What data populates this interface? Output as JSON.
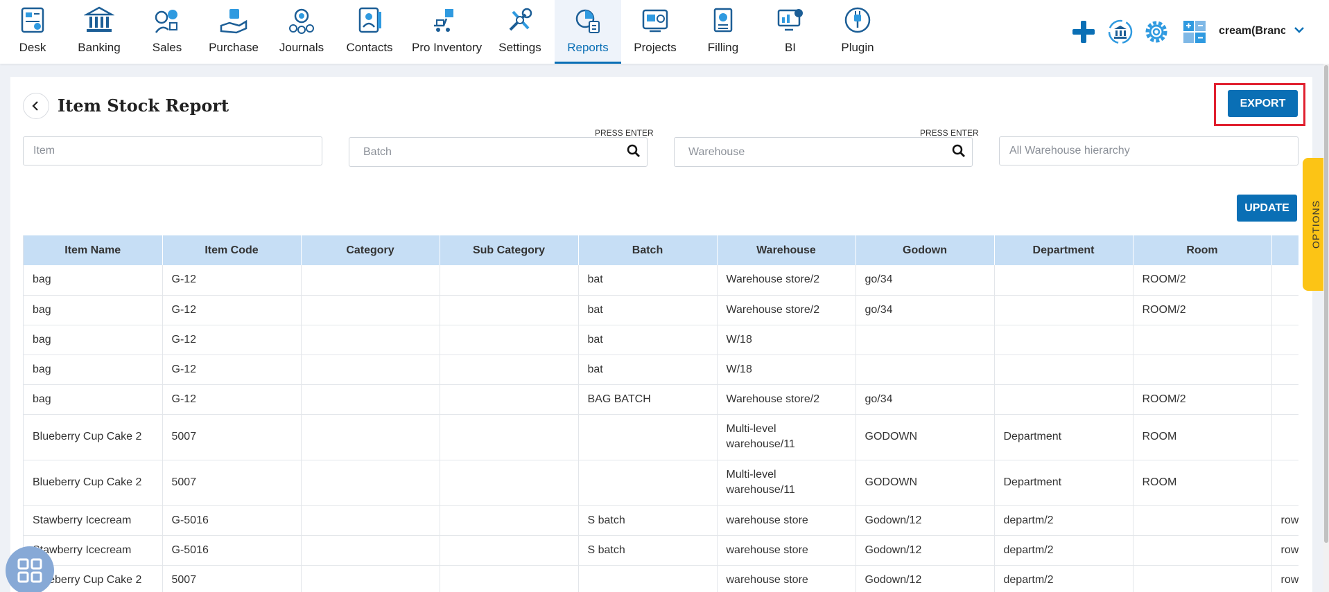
{
  "nav": {
    "items": [
      {
        "label": "Desk",
        "icon": "desk-icon"
      },
      {
        "label": "Banking",
        "icon": "bank-icon"
      },
      {
        "label": "Sales",
        "icon": "sales-icon"
      },
      {
        "label": "Purchase",
        "icon": "purchase-icon"
      },
      {
        "label": "Journals",
        "icon": "journal-icon"
      },
      {
        "label": "Contacts",
        "icon": "contacts-icon"
      },
      {
        "label": "Pro Inventory",
        "icon": "inventory-icon"
      },
      {
        "label": "Settings",
        "icon": "tools-icon"
      },
      {
        "label": "Reports",
        "icon": "reports-icon",
        "active": true
      },
      {
        "label": "Projects",
        "icon": "projects-icon"
      },
      {
        "label": "Filling",
        "icon": "filing-icon"
      },
      {
        "label": "BI",
        "icon": "bi-icon"
      },
      {
        "label": "Plugin",
        "icon": "plugin-icon"
      }
    ],
    "user_name": "cream(Branch"
  },
  "page": {
    "title": "Item Stock Report",
    "export_label": "EXPORT",
    "update_label": "UPDATE",
    "options_label": "OPTIONS",
    "press_enter": "PRESS ENTER"
  },
  "filters": {
    "item_placeholder": "Item",
    "batch_placeholder": "Batch",
    "warehouse_placeholder": "Warehouse",
    "hierarchy_placeholder": "All Warehouse hierarchy"
  },
  "table": {
    "headers": [
      "Item Name",
      "Item Code",
      "Category",
      "Sub Category",
      "Batch",
      "Warehouse",
      "Godown",
      "Department",
      "Room",
      ""
    ],
    "rows": [
      [
        "bag",
        "G-12",
        "",
        "",
        "bat",
        "Warehouse store/2",
        "go/34",
        "",
        "ROOM/2",
        ""
      ],
      [
        "bag",
        "G-12",
        "",
        "",
        "bat",
        "Warehouse store/2",
        "go/34",
        "",
        "ROOM/2",
        ""
      ],
      [
        "bag",
        "G-12",
        "",
        "",
        "bat",
        "W/18",
        "",
        "",
        "",
        ""
      ],
      [
        "bag",
        "G-12",
        "",
        "",
        "bat",
        "W/18",
        "",
        "",
        "",
        ""
      ],
      [
        "bag",
        "G-12",
        "",
        "",
        "BAG BATCH",
        "Warehouse store/2",
        "go/34",
        "",
        "ROOM/2",
        ""
      ],
      [
        "Blueberry Cup Cake 2",
        "5007",
        "",
        "",
        "",
        "Multi-level warehouse/11",
        "GODOWN",
        "Department",
        "ROOM",
        ""
      ],
      [
        "Blueberry Cup Cake 2",
        "5007",
        "",
        "",
        "",
        "Multi-level warehouse/11",
        "GODOWN",
        "Department",
        "ROOM",
        ""
      ],
      [
        "Stawberry Icecream",
        "G-5016",
        "",
        "",
        "S batch",
        "warehouse store",
        "Godown/12",
        "departm/2",
        "",
        "row"
      ],
      [
        "Stawberry Icecream",
        "G-5016",
        "",
        "",
        "S batch",
        "warehouse store",
        "Godown/12",
        "departm/2",
        "",
        "row"
      ],
      [
        "Blueberry Cup Cake 2",
        "5007",
        "",
        "",
        "",
        "warehouse store",
        "Godown/12",
        "departm/2",
        "",
        "row"
      ]
    ]
  },
  "colors": {
    "primary": "#0a6fb5",
    "header_bg": "#c6def5",
    "options_tab": "#fcc415",
    "highlight": "#e0202f"
  }
}
